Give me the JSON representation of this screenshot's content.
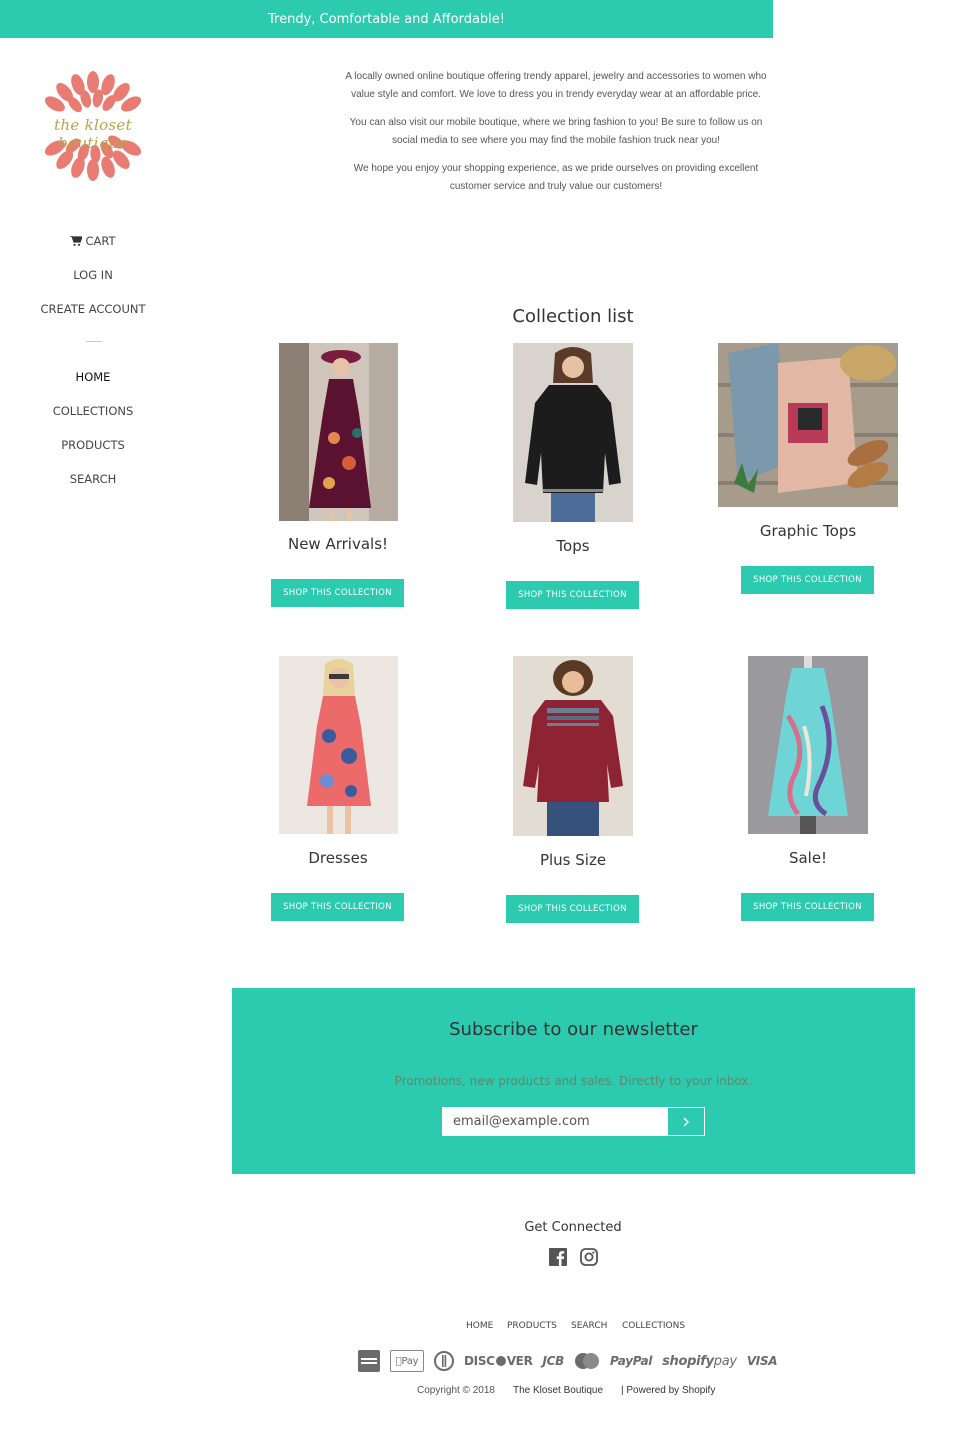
{
  "announcement": "Trendy, Comfortable and Affordable!",
  "brand": {
    "logo_text": "the kloset boutique",
    "logo_color": "#e87c72",
    "accent": "#2ccbb0"
  },
  "sidebar": {
    "account": [
      {
        "label": "CART",
        "icon": "cart-icon"
      },
      {
        "label": "LOG IN"
      },
      {
        "label": "CREATE ACCOUNT"
      }
    ],
    "nav": [
      {
        "label": "HOME",
        "active": true
      },
      {
        "label": "COLLECTIONS"
      },
      {
        "label": "PRODUCTS"
      },
      {
        "label": "SEARCH"
      }
    ]
  },
  "intro": [
    "A locally owned online boutique offering trendy apparel, jewelry and accessories to women who value style and comfort. We love to dress you in trendy everyday wear at an affordable price.",
    "You can also visit our mobile boutique, where we bring fashion to you! Be sure to follow us on social media to see where you may find the mobile fashion truck near you!",
    "We hope you enjoy your shopping experience, as we pride ourselves on providing excellent customer service and truly value our customers!"
  ],
  "collection_list": {
    "title": "Collection list",
    "button_label": "SHOP THIS COLLECTION",
    "items": [
      {
        "name": "New Arrivals!"
      },
      {
        "name": "Tops"
      },
      {
        "name": "Graphic Tops"
      },
      {
        "name": "Dresses"
      },
      {
        "name": "Plus Size"
      },
      {
        "name": "Sale!"
      }
    ]
  },
  "newsletter": {
    "title": "Subscribe to our newsletter",
    "subtitle": "Promotions, new products and sales. Directly to your inbox.",
    "placeholder": "email@example.com",
    "submit_icon": "chevron-right-icon"
  },
  "footer": {
    "get_connected": "Get Connected",
    "social": [
      "facebook-icon",
      "instagram-icon"
    ],
    "nav": [
      "HOME",
      "PRODUCTS",
      "SEARCH",
      "COLLECTIONS"
    ],
    "payments": [
      "American Express",
      "Apple Pay",
      "Diners Club",
      "DISCOVER",
      "JCB",
      "MasterCard",
      "PayPal",
      "shopify pay",
      "VISA"
    ],
    "copyright": "Copyright © 2018",
    "store_name": "The Kloset Boutique",
    "powered": "| Powered by Shopify"
  }
}
